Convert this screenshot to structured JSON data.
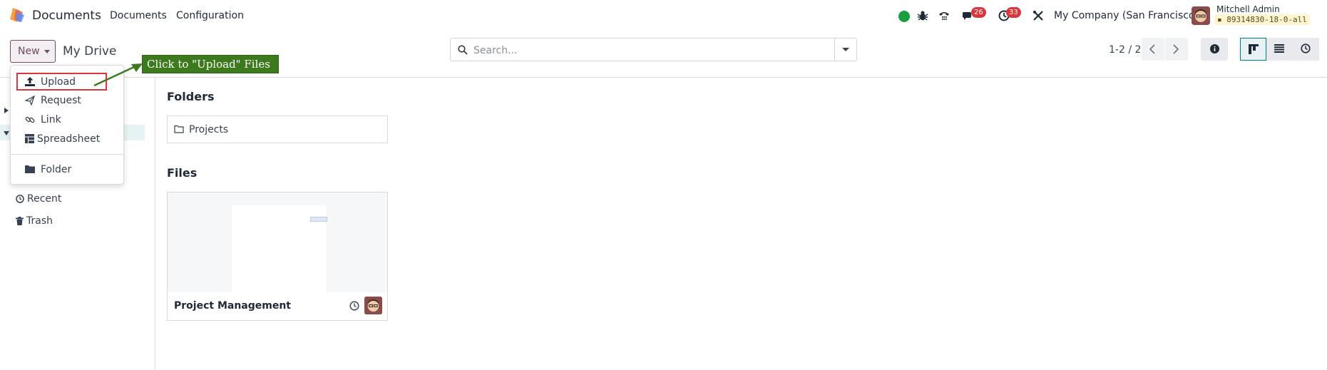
{
  "navbar": {
    "app_title": "Documents",
    "menus": [
      "Documents",
      "Configuration"
    ],
    "icons": [
      "status-dot-icon",
      "bug-icon",
      "phone-icon",
      "chat-icon",
      "activity-clock-icon",
      "tools-icon"
    ],
    "messages_badge": "26",
    "activities_badge": "33",
    "company": "My Company (San Francisco)",
    "user_name": "Mitchell Admin",
    "database": "89314830-18-0-all",
    "colors": {
      "status_online": "#1a9e3f",
      "badge": "#d9363e",
      "brand": "#714b67"
    }
  },
  "control_panel": {
    "new_label": "New",
    "breadcrumb": "My Drive",
    "search_placeholder": "Search...",
    "pager": "1-2 / 2",
    "view_buttons": [
      "info-icon",
      "kanban-view-icon",
      "list-view-icon",
      "activity-view-icon"
    ],
    "active_view": "kanban"
  },
  "new_menu": {
    "items": [
      {
        "label": "Upload",
        "icon": "upload-icon",
        "highlighted": true
      },
      {
        "label": "Request",
        "icon": "paper-plane-icon"
      },
      {
        "label": "Link",
        "icon": "link-icon"
      },
      {
        "label": "Spreadsheet",
        "icon": "spreadsheet-icon"
      },
      {
        "label": "Folder",
        "icon": "folder-icon"
      }
    ]
  },
  "callout": {
    "text": "Click to \"Upload\" Files",
    "color": "#3d7a1e"
  },
  "sidebar": {
    "items": [
      {
        "label": "Recent",
        "icon": "clock-icon"
      },
      {
        "label": "Trash",
        "icon": "trash-icon"
      }
    ]
  },
  "main": {
    "folders_title": "Folders",
    "folders": [
      {
        "name": "Projects",
        "icon": "folder-outline-icon"
      }
    ],
    "files_title": "Files",
    "files": [
      {
        "name": "Project Management",
        "activity_icon": "clock-icon"
      }
    ]
  }
}
